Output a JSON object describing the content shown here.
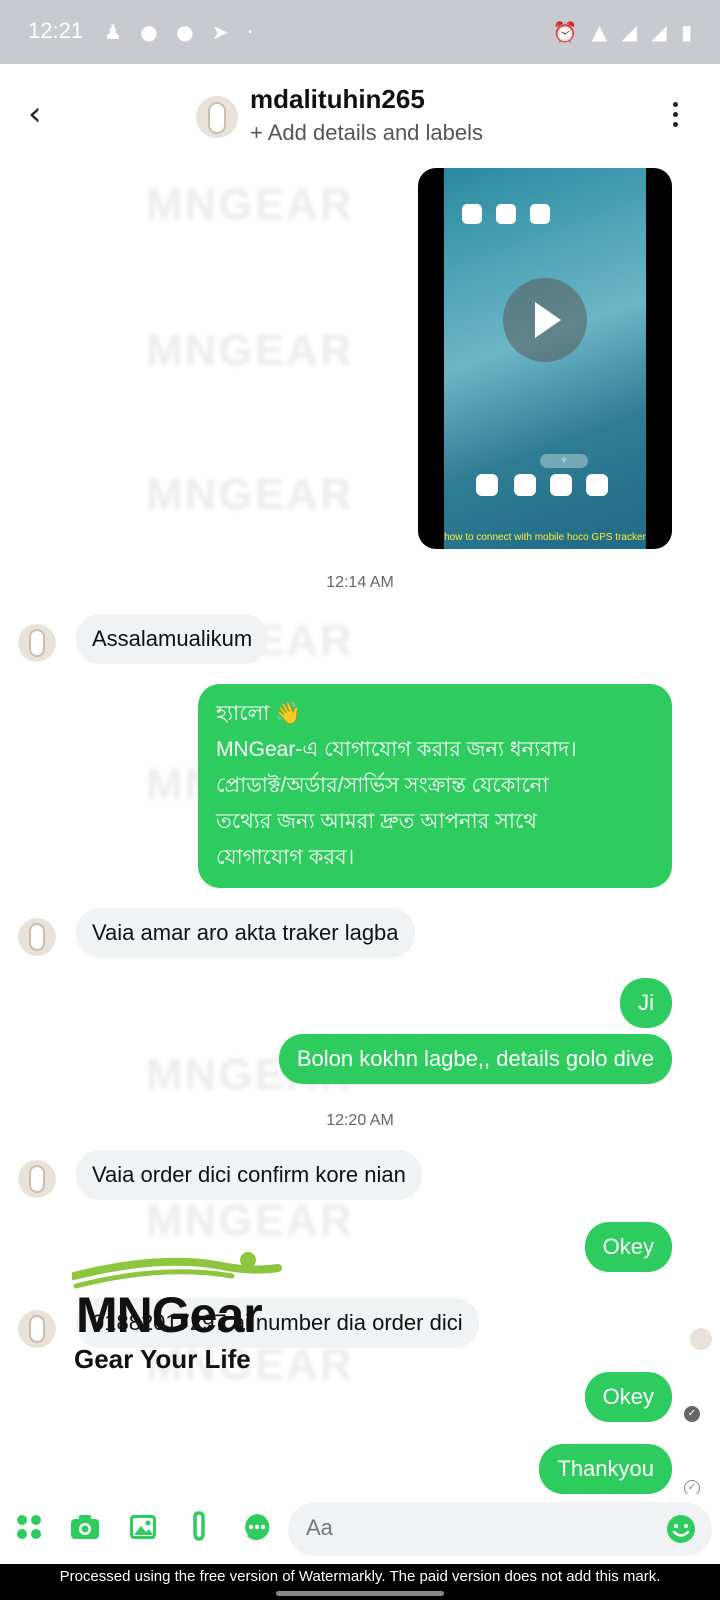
{
  "status_bar": {
    "time": "12:21"
  },
  "header": {
    "contact_name": "mdalituhin265",
    "subtitle": "+ Add details and labels"
  },
  "background_watermark": "MNGEAR",
  "video": {
    "caption": "how to connect with mobile hoco GPS tracker"
  },
  "timestamps": [
    "12:14 AM",
    "12:20 AM"
  ],
  "messages": {
    "m1": "Assalamualikum",
    "m2_lines": [
      "হ্যালো 👋",
      "MNGear-এ যোগাযোগ করার জন্য ধন্যবাদ।",
      "প্রোডাক্ট/অর্ডার/সার্ভিস সংক্রান্ত যেকোনো",
      "তথ্যের জন্য আমরা দ্রুত আপনার সাথে",
      "যোগাযোগ করব।"
    ],
    "m3": "Vaia amar aro akta traker lagba",
    "m4": "Ji",
    "m5": "Bolon kokhn lagbe,, details golo dive",
    "m6": "Vaia order dici confirm kore nian",
    "m7": "Okey",
    "m8": "01882017297 ai number dia order dici",
    "m9": "Okey",
    "m10": "Thankyou"
  },
  "logo": {
    "brand": "MNGear",
    "tagline": "Gear Your Life"
  },
  "composer": {
    "placeholder": "Aa"
  },
  "footer": {
    "notice": "Processed using the free version of Watermarkly. The paid version does not add this mark."
  },
  "colors": {
    "outgoing_bubble": "#2ecc5f",
    "incoming_bubble": "#f1f2f4",
    "accent": "#2ecc5f"
  }
}
